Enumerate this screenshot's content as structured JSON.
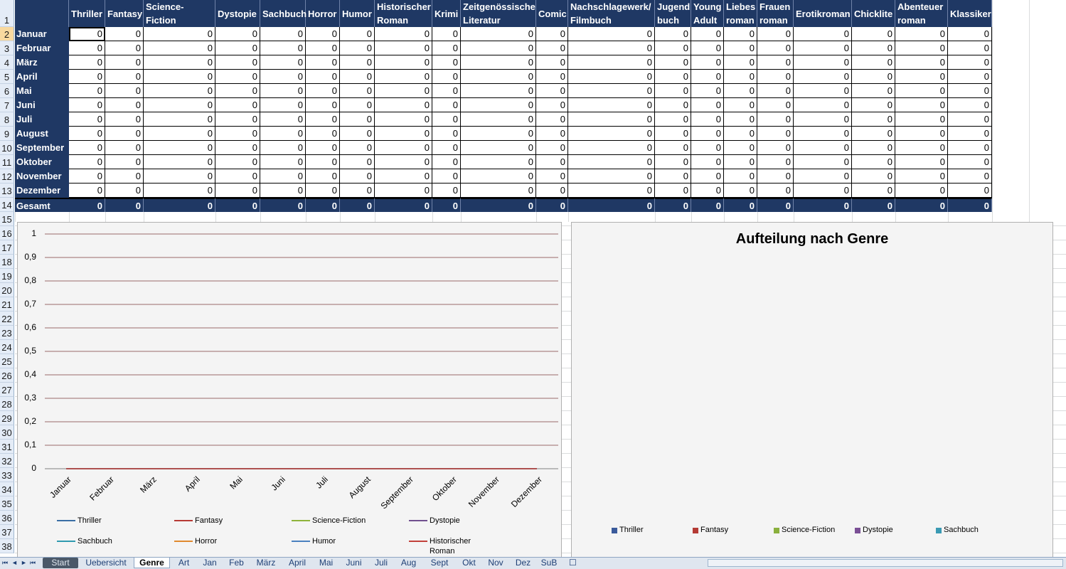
{
  "columns": [
    "",
    "Thriller",
    "Fantasy",
    "Science-Fiction",
    "Dystopie",
    "Sachbuch",
    "Horror",
    "Humor",
    "Historischer\nRoman",
    "Krimi",
    "Zeitgenössische\nLiteratur",
    "Comic",
    "Nachschlagewerk/\nFilmbuch",
    "Jugend\nbuch",
    "Young\nAdult",
    "Liebes\nroman",
    "Frauen\nroman",
    "Erotikroman",
    "Chicklite",
    "Abenteuer\nroman",
    "Klassiker"
  ],
  "months": [
    "Januar",
    "Februar",
    "März",
    "April",
    "Mai",
    "Juni",
    "Juli",
    "August",
    "September",
    "Oktober",
    "November",
    "Dezember"
  ],
  "cell_value": "0",
  "total_label": "Gesamt",
  "row_numbers": [
    "1",
    "2",
    "3",
    "4",
    "5",
    "6",
    "7",
    "8",
    "9",
    "10",
    "11",
    "12",
    "13",
    "14",
    "15",
    "16",
    "17",
    "18",
    "19",
    "20",
    "21",
    "22",
    "23",
    "24",
    "25",
    "26",
    "27",
    "28",
    "29",
    "30",
    "31",
    "32",
    "33",
    "34",
    "35",
    "36",
    "37",
    "38"
  ],
  "line_chart": {
    "yticks": [
      "1",
      "0,9",
      "0,8",
      "0,7",
      "0,6",
      "0,5",
      "0,4",
      "0,3",
      "0,2",
      "0,1",
      "0"
    ],
    "legend": [
      {
        "name": "Thriller",
        "color": "#3a6ea5"
      },
      {
        "name": "Fantasy",
        "color": "#b73a34"
      },
      {
        "name": "Science-Fiction",
        "color": "#8eb33b"
      },
      {
        "name": "Dystopie",
        "color": "#70508f"
      },
      {
        "name": "Sachbuch",
        "color": "#2f9ab0"
      },
      {
        "name": "Horror",
        "color": "#e08a2e"
      },
      {
        "name": "Humor",
        "color": "#4a80bf"
      },
      {
        "name": "Historischer\nRoman",
        "color": "#c2403a"
      }
    ]
  },
  "pie_chart": {
    "title": "Aufteilung nach Genre",
    "legend": [
      {
        "name": "Thriller",
        "color": "#3a5a9b"
      },
      {
        "name": "Fantasy",
        "color": "#b43a35"
      },
      {
        "name": "Science-Fiction",
        "color": "#8ab03d"
      },
      {
        "name": "Dystopie",
        "color": "#7a4f95"
      },
      {
        "name": "Sachbuch",
        "color": "#3a9ab3"
      }
    ]
  },
  "chart_data": [
    {
      "type": "line",
      "title": "",
      "x": [
        "Januar",
        "Februar",
        "März",
        "April",
        "Mai",
        "Juni",
        "Juli",
        "August",
        "September",
        "Oktober",
        "November",
        "Dezember"
      ],
      "series": [
        {
          "name": "Thriller",
          "values": [
            0,
            0,
            0,
            0,
            0,
            0,
            0,
            0,
            0,
            0,
            0,
            0
          ]
        },
        {
          "name": "Fantasy",
          "values": [
            0,
            0,
            0,
            0,
            0,
            0,
            0,
            0,
            0,
            0,
            0,
            0
          ]
        },
        {
          "name": "Science-Fiction",
          "values": [
            0,
            0,
            0,
            0,
            0,
            0,
            0,
            0,
            0,
            0,
            0,
            0
          ]
        },
        {
          "name": "Dystopie",
          "values": [
            0,
            0,
            0,
            0,
            0,
            0,
            0,
            0,
            0,
            0,
            0,
            0
          ]
        },
        {
          "name": "Sachbuch",
          "values": [
            0,
            0,
            0,
            0,
            0,
            0,
            0,
            0,
            0,
            0,
            0,
            0
          ]
        },
        {
          "name": "Horror",
          "values": [
            0,
            0,
            0,
            0,
            0,
            0,
            0,
            0,
            0,
            0,
            0,
            0
          ]
        },
        {
          "name": "Humor",
          "values": [
            0,
            0,
            0,
            0,
            0,
            0,
            0,
            0,
            0,
            0,
            0,
            0
          ]
        },
        {
          "name": "Historischer Roman",
          "values": [
            0,
            0,
            0,
            0,
            0,
            0,
            0,
            0,
            0,
            0,
            0,
            0
          ]
        }
      ],
      "ylim": [
        0,
        1
      ],
      "grid": true,
      "legend_position": "bottom"
    },
    {
      "type": "pie",
      "title": "Aufteilung nach Genre",
      "categories": [
        "Thriller",
        "Fantasy",
        "Science-Fiction",
        "Dystopie",
        "Sachbuch"
      ],
      "values": [
        0,
        0,
        0,
        0,
        0
      ],
      "legend_position": "bottom"
    }
  ],
  "sheet_tabs": [
    "Start",
    "Uebersicht",
    "Genre",
    "Art",
    "Jan",
    "Feb",
    "März",
    "April",
    "Mai",
    "Juni",
    "Juli",
    "Aug",
    "Sept",
    "Okt",
    "Nov",
    "Dez",
    "SuB"
  ],
  "active_tab": "Genre"
}
